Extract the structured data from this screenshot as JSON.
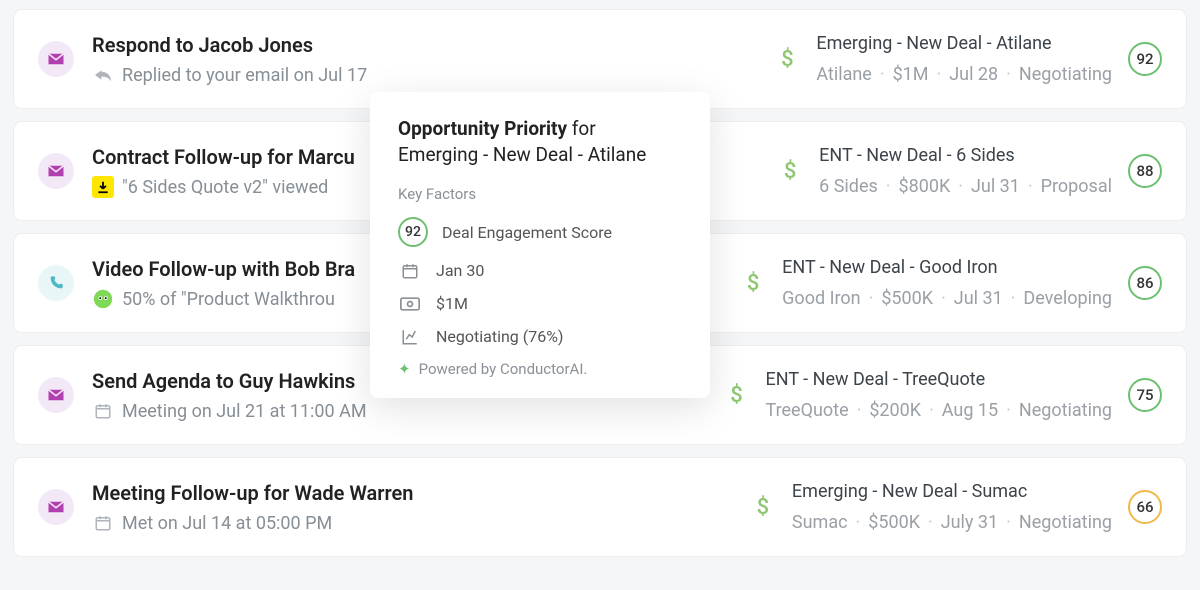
{
  "rows": [
    {
      "icon": "mail",
      "title": "Respond to Jacob Jones",
      "sub_icon": "reply",
      "sub_text": "Replied to your email on Jul 17",
      "deal_title": "Emerging - New Deal - Atilane",
      "deal_account": "Atilane",
      "deal_amount": "$1M",
      "deal_date": "Jul 28",
      "deal_stage": "Negotiating",
      "score": 92,
      "score_class": ""
    },
    {
      "icon": "mail",
      "title": "Contract Follow-up for Marcu",
      "sub_icon": "download",
      "sub_text": "\"6 Sides Quote v2\" viewed",
      "deal_title": "ENT - New Deal - 6 Sides",
      "deal_account": "6 Sides",
      "deal_amount": "$800K",
      "deal_date": "Jul 31",
      "deal_stage": "Proposal",
      "score": 88,
      "score_class": ""
    },
    {
      "icon": "phone",
      "title": "Video Follow-up with Bob Bra",
      "sub_icon": "alien",
      "sub_text": "50% of \"Product Walkthrou",
      "deal_title": "ENT - New Deal - Good Iron",
      "deal_account": "Good Iron",
      "deal_amount": "$500K",
      "deal_date": "Jul 31",
      "deal_stage": "Developing",
      "score": 86,
      "score_class": ""
    },
    {
      "icon": "mail",
      "title": "Send Agenda to Guy Hawkins",
      "sub_icon": "calendar",
      "sub_text": "Meeting on Jul 21 at 11:00 AM",
      "deal_title": "ENT - New Deal - TreeQuote",
      "deal_account": "TreeQuote",
      "deal_amount": "$200K",
      "deal_date": "Aug 15",
      "deal_stage": "Negotiating",
      "score": 75,
      "score_class": ""
    },
    {
      "icon": "mail",
      "title": "Meeting Follow-up for Wade Warren",
      "sub_icon": "calendar",
      "sub_text": "Met on Jul 14  at 05:00 PM",
      "deal_title": "Emerging - New Deal - Sumac",
      "deal_account": "Sumac",
      "deal_amount": "$500K",
      "deal_date": "July 31",
      "deal_stage": "Negotiating",
      "score": 66,
      "score_class": "amber"
    }
  ],
  "popover": {
    "heading_strong": "Opportunity Priority",
    "heading_rest": "for",
    "heading_line2": "Emerging - New Deal - Atilane",
    "key_factors_label": "Key Factors",
    "factor_score": 92,
    "factor_score_label": "Deal Engagement Score",
    "factor_date": "Jan 30",
    "factor_amount": "$1M",
    "factor_stage": "Negotiating (76%)",
    "footer": "Powered by ConductorAI."
  }
}
